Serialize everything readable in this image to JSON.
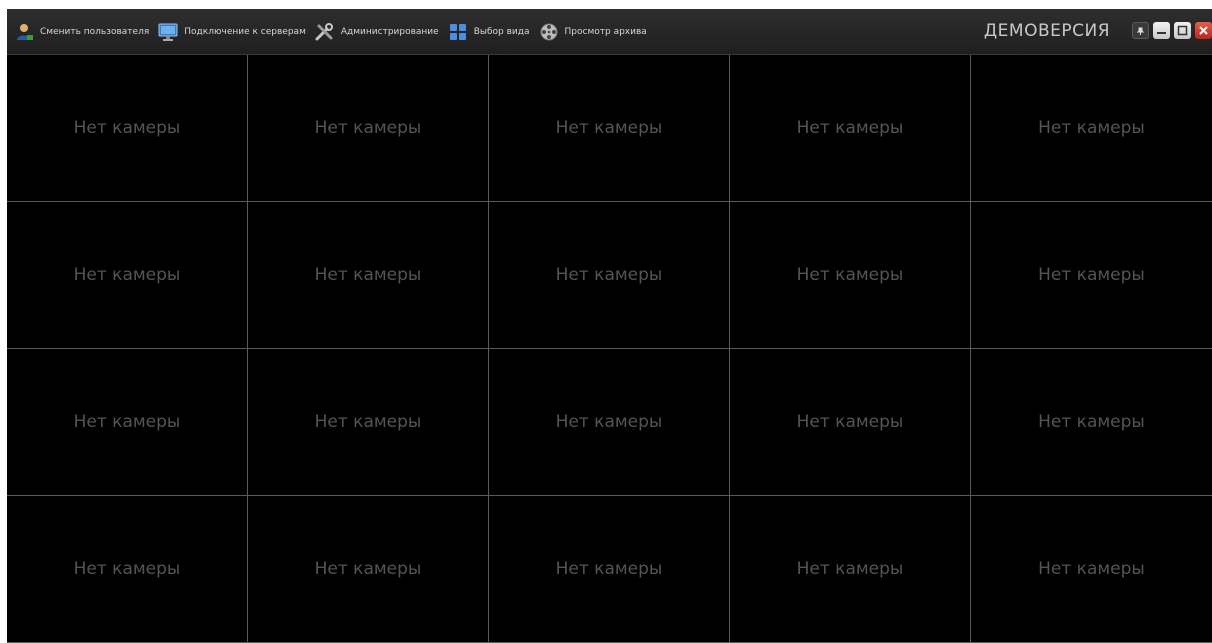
{
  "toolbar": {
    "items": [
      {
        "label": "Сменить пользователя",
        "icon": "user-icon"
      },
      {
        "label": "Подключение к серверам",
        "icon": "monitor-icon"
      },
      {
        "label": "Администрирование",
        "icon": "tools-icon"
      },
      {
        "label": "Выбор вида",
        "icon": "layout-grid-icon"
      },
      {
        "label": "Просмотр архива",
        "icon": "film-reel-icon"
      }
    ],
    "brand": "ДЕМОВЕРСИЯ"
  },
  "grid": {
    "rows": 4,
    "columns": 5,
    "cells": [
      "Нет камеры",
      "Нет камеры",
      "Нет камеры",
      "Нет камеры",
      "Нет камеры",
      "Нет камеры",
      "Нет камеры",
      "Нет камеры",
      "Нет камеры",
      "Нет камеры",
      "Нет камеры",
      "Нет камеры",
      "Нет камеры",
      "Нет камеры",
      "Нет камеры",
      "Нет камеры",
      "Нет камеры",
      "Нет камеры",
      "Нет камеры",
      "Нет камеры"
    ]
  },
  "colors": {
    "background": "#000000",
    "toolbar": "#252525",
    "cell_text": "#545454",
    "grid_line": "#5a5a5a",
    "close_button": "#d23a2c"
  }
}
